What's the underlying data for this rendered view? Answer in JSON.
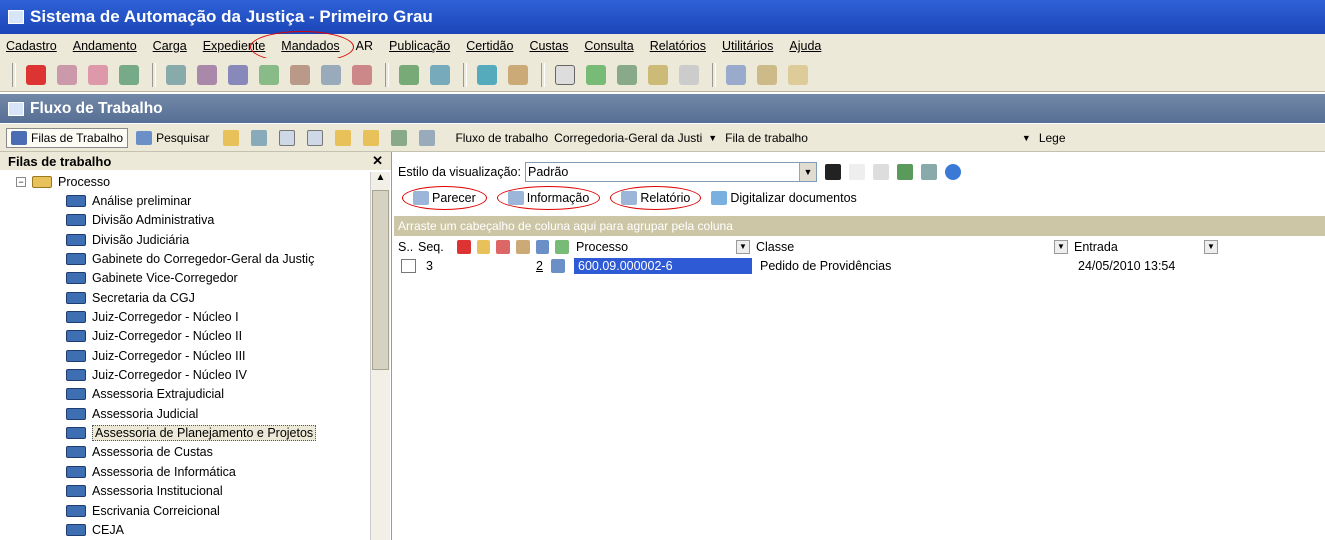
{
  "app": {
    "title": "Sistema de Automação da Justiça - Primeiro Grau"
  },
  "menu": [
    "Cadastro",
    "Andamento",
    "Carga",
    "Expediente",
    "Mandados",
    "AR",
    "Publicação",
    "Certidão",
    "Custas",
    "Consulta",
    "Relatórios",
    "Utilitários",
    "Ajuda"
  ],
  "panel": {
    "title": "Fluxo de Trabalho"
  },
  "workflow_toolbar": {
    "filas_label": "Filas de Trabalho",
    "pesquisar_label": "Pesquisar",
    "fluxo_label": "Fluxo de trabalho",
    "fluxo_value": "Corregedoria-Geral da Justi",
    "fila_label": "Fila de trabalho",
    "legend_label": "Lege"
  },
  "sidebar": {
    "title": "Filas de trabalho",
    "root": "Processo",
    "items": [
      "Análise preliminar",
      "Divisão Administrativa",
      "Divisão Judiciária",
      "Gabinete do Corregedor-Geral da Justiç",
      "Gabinete Vice-Corregedor",
      "Secretaria da CGJ",
      "Juiz-Corregedor - Núcleo I",
      "Juiz-Corregedor - Núcleo II",
      "Juiz-Corregedor - Núcleo III",
      "Juiz-Corregedor - Núcleo IV",
      "Assessoria Extrajudicial",
      "Assessoria Judicial",
      "Assessoria de Planejamento e Projetos",
      "Assessoria de Custas",
      "Assessoria de Informática",
      "Assessoria Institucional",
      "Escrivania Correicional",
      "CEJA"
    ],
    "selected_index": 12
  },
  "main": {
    "view_label": "Estilo da visualização:",
    "view_value": "Padrão",
    "actions": {
      "parecer": "Parecer",
      "informacao": "Informação",
      "relatorio": "Relatório",
      "digitalizar": "Digitalizar documentos"
    },
    "group_hint": "Arraste um cabeçalho de coluna aqui para agrupar pela coluna",
    "columns": {
      "s": "S..",
      "seq": "Seq.",
      "processo": "Processo",
      "classe": "Classe",
      "entrada": "Entrada"
    },
    "rows": [
      {
        "seq": "3",
        "count": "2",
        "processo": "600.09.000002-6",
        "classe": "Pedido de Providências",
        "entrada": "24/05/2010 13:54"
      }
    ]
  },
  "colors": {
    "title_blue": "#2f62d6",
    "panel_blue": "#566f94",
    "chrome": "#ece9d8",
    "annotation_red": "#e00000",
    "selection_blue": "#2f5ad6"
  }
}
